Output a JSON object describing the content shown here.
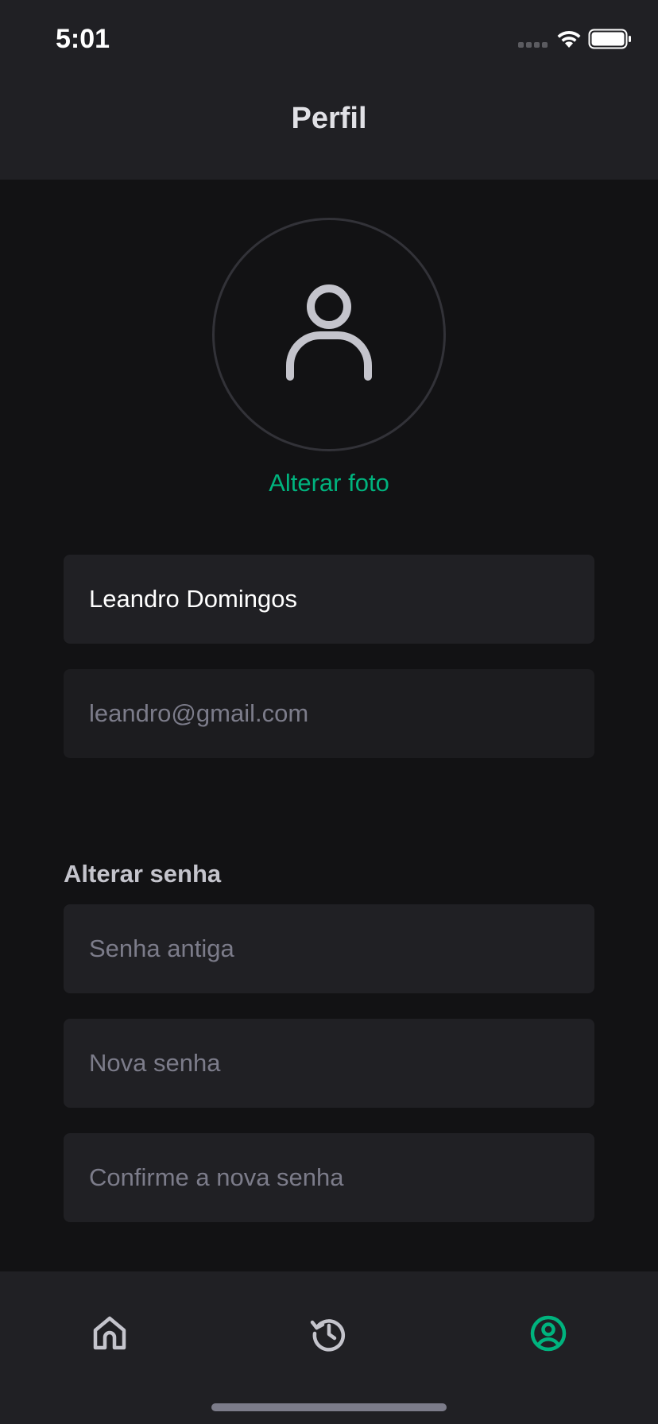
{
  "status_bar": {
    "time": "5:01"
  },
  "header": {
    "title": "Perfil"
  },
  "profile": {
    "change_photo_label": "Alterar foto"
  },
  "form": {
    "name_value": "Leandro Domingos",
    "email_value": "leandro@gmail.com",
    "password_section_label": "Alterar senha",
    "old_password_placeholder": "Senha antiga",
    "new_password_placeholder": "Nova senha",
    "confirm_password_placeholder": "Confirme a nova senha"
  },
  "tabbar": {
    "items": [
      {
        "icon": "home-icon",
        "active": false
      },
      {
        "icon": "history-icon",
        "active": false
      },
      {
        "icon": "profile-icon",
        "active": true
      }
    ]
  },
  "colors": {
    "accent": "#00b37e",
    "background": "#121214",
    "surface": "#202024",
    "text_primary": "#e1e1e6",
    "text_muted": "#7c7c8a"
  }
}
